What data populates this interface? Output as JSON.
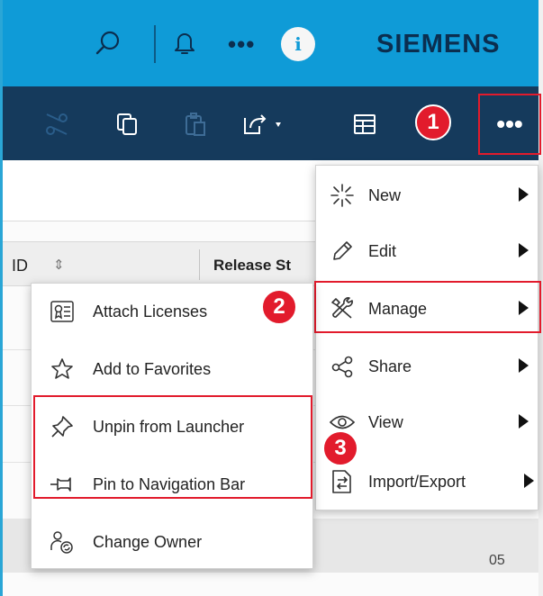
{
  "header": {
    "brand": "SIEMENS",
    "user_initial": "i",
    "more_label": "•••"
  },
  "toolbar": {
    "more_label": "•••"
  },
  "table": {
    "col_id": "ID",
    "col_release": "Release St",
    "visible_value": "05"
  },
  "main_menu": [
    {
      "label": "New",
      "icon": "new-icon",
      "submenu": true
    },
    {
      "label": "Edit",
      "icon": "pencil-icon",
      "submenu": true
    },
    {
      "label": "Manage",
      "icon": "tools-icon",
      "submenu": true
    },
    {
      "label": "Share",
      "icon": "share-icon",
      "submenu": true
    },
    {
      "label": "View",
      "icon": "eye-icon",
      "submenu": true
    },
    {
      "label": "Import/Export",
      "icon": "import-export-icon",
      "submenu": true
    }
  ],
  "manage_submenu": [
    {
      "label": "Attach Licenses",
      "icon": "license-icon"
    },
    {
      "label": "Add to Favorites",
      "icon": "star-icon"
    },
    {
      "label": "Unpin from Launcher",
      "icon": "unpin-icon"
    },
    {
      "label": "Pin to Navigation Bar",
      "icon": "pin-icon"
    },
    {
      "label": "Change Owner",
      "icon": "change-owner-icon"
    }
  ],
  "callouts": [
    "1",
    "2",
    "3"
  ],
  "colors": {
    "header_bg": "#0f9bd7",
    "toolbar_bg": "#153a5c",
    "highlight": "#e21b2c"
  }
}
